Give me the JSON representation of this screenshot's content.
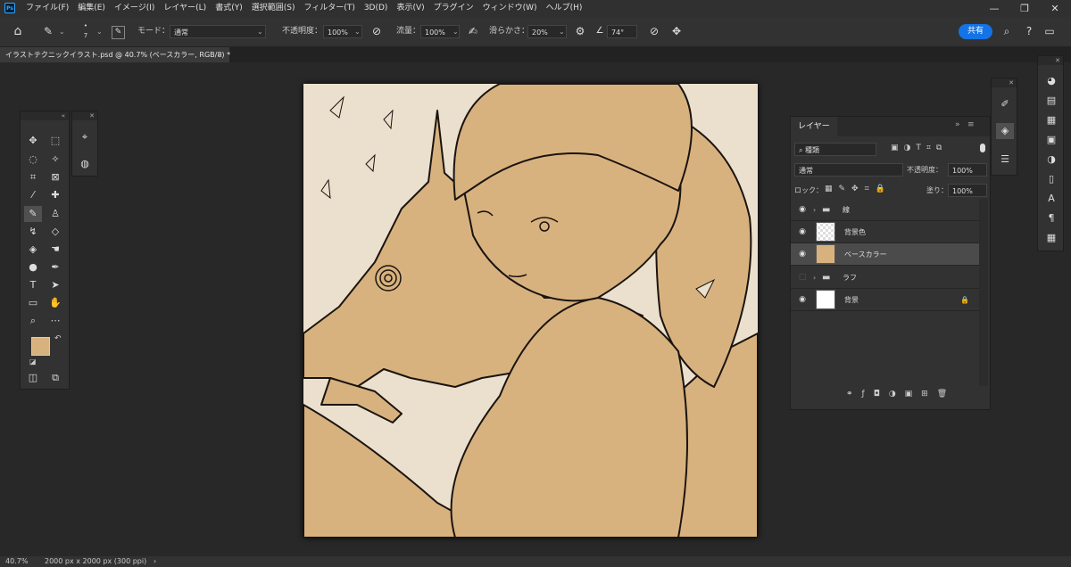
{
  "menubar": {
    "items": [
      "ファイル(F)",
      "編集(E)",
      "イメージ(I)",
      "レイヤー(L)",
      "書式(Y)",
      "選択範囲(S)",
      "フィルター(T)",
      "3D(D)",
      "表示(V)",
      "プラグイン",
      "ウィンドウ(W)",
      "ヘルプ(H)"
    ]
  },
  "options": {
    "brush_size": "7",
    "mode_label": "モード：",
    "mode_value": "通常",
    "opacity_label": "不透明度：",
    "opacity_value": "100%",
    "flow_label": "流量：",
    "flow_value": "100%",
    "smoothing_label": "滑らかさ：",
    "smoothing_value": "20%",
    "angle_value": "74°",
    "share_label": "共有"
  },
  "document": {
    "tab_title": "イラストテクニックイラスト.psd @ 40.7% (ベースカラー, RGB/8) *",
    "close_glyph": "×"
  },
  "layers_panel": {
    "title": "レイヤー",
    "filter_kind": "種類",
    "blend_mode": "通常",
    "opacity_label": "不透明度：",
    "opacity_value": "100%",
    "lock_label": "ロック：",
    "fill_label": "塗り：",
    "fill_value": "100%",
    "layers": [
      {
        "name": "線",
        "type": "group"
      },
      {
        "name": "背景色",
        "type": "transparent"
      },
      {
        "name": "ベースカラー",
        "type": "color",
        "selected": true
      },
      {
        "name": "ラフ",
        "type": "group",
        "hidden": true
      },
      {
        "name": "背景",
        "type": "white",
        "locked": true
      }
    ]
  },
  "status": {
    "zoom": "40.7%",
    "doc_size": "2000 px x 2000 px (300 ppi)"
  },
  "colors": {
    "foreground": "#d8b27e",
    "background": "#ffffff",
    "accent": "#1473e6"
  }
}
